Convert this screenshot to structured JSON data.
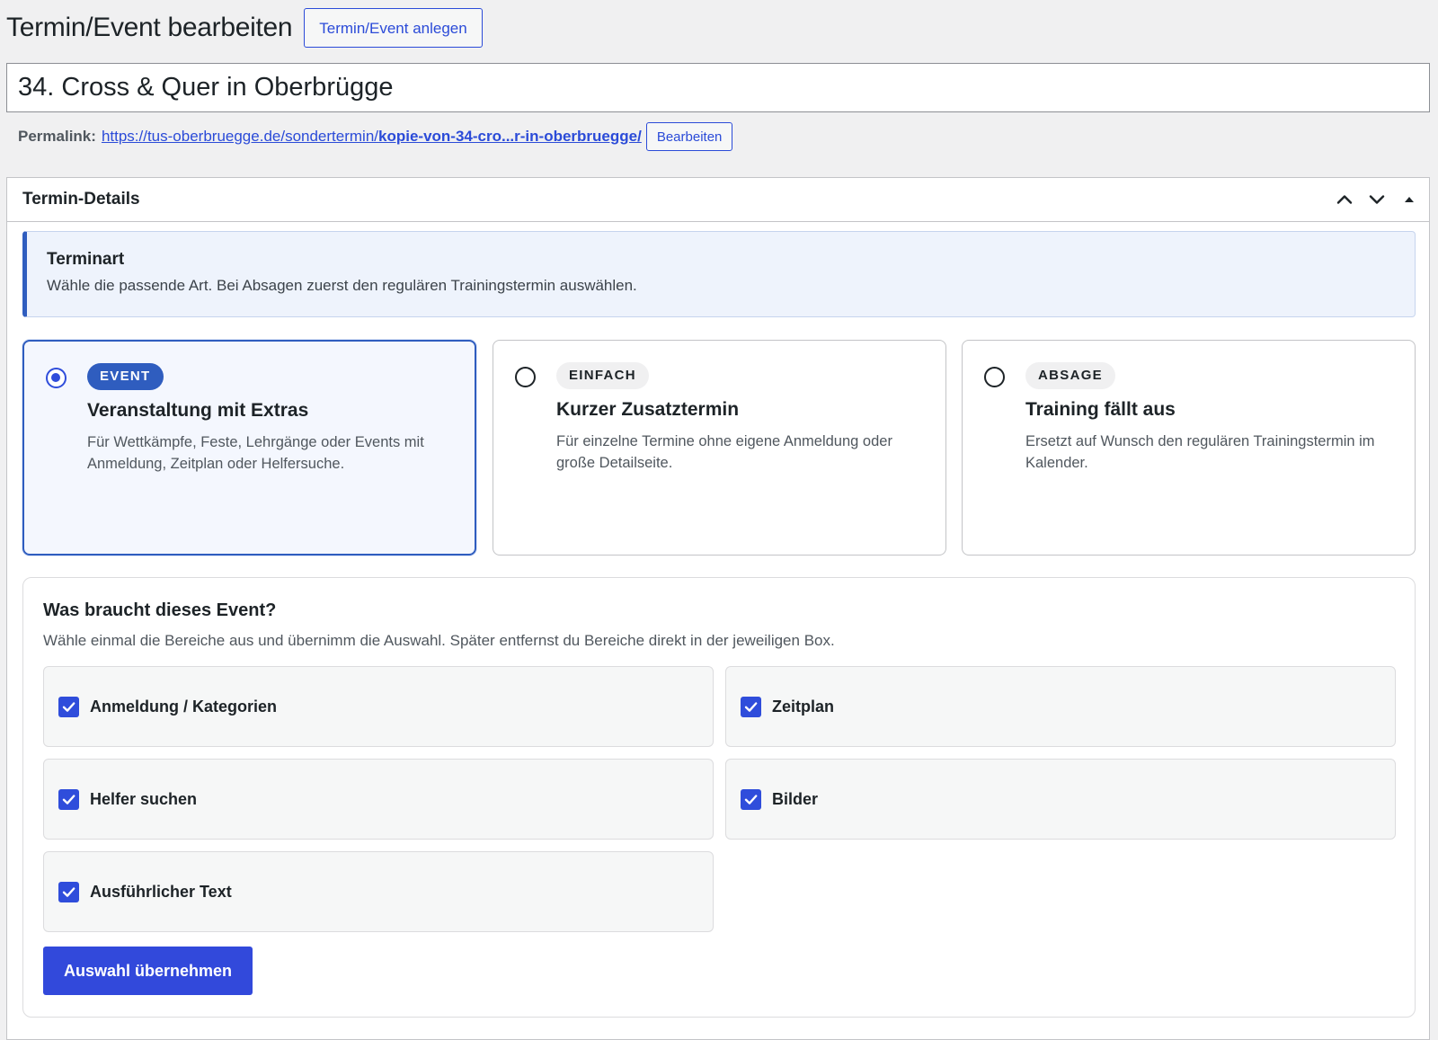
{
  "header": {
    "title": "Termin/Event bearbeiten",
    "add_new_label": "Termin/Event anlegen"
  },
  "post": {
    "title": "34. Cross & Quer in Oberbrügge",
    "permalink_label": "Permalink:",
    "permalink_base": "https://tus-oberbruegge.de/sondertermin/",
    "permalink_slug": "kopie-von-34-cro...r-in-oberbruegge/",
    "permalink_edit_label": "Bearbeiten"
  },
  "metabox": {
    "title": "Termin-Details",
    "actions": [
      "chevron-up-icon",
      "chevron-down-icon",
      "caret-up-icon"
    ],
    "notice": {
      "title": "Terminart",
      "text": "Wähle die passende Art. Bei Absagen zuerst den regulären Trainingstermin auswählen."
    },
    "types": [
      {
        "badge": "EVENT",
        "title": "Veranstaltung mit Extras",
        "description": "Für Wettkämpfe, Feste, Lehrgänge oder Events mit Anmeldung, Zeitplan oder Helfersuche.",
        "selected": true
      },
      {
        "badge": "EINFACH",
        "title": "Kurzer Zusatztermin",
        "description": "Für einzelne Termine ohne eigene Anmeldung oder große Detailseite.",
        "selected": false
      },
      {
        "badge": "ABSAGE",
        "title": "Training fällt aus",
        "description": "Ersetzt auf Wunsch den regulären Trainingstermin im Kalender.",
        "selected": false
      }
    ],
    "needs": {
      "title": "Was braucht dieses Event?",
      "subtitle": "Wähle einmal die Bereiche aus und übernimm die Auswahl. Später entfernst du Bereiche direkt in der jeweiligen Box.",
      "options": [
        {
          "label": "Anmeldung / Kategorien",
          "checked": true
        },
        {
          "label": "Zeitplan",
          "checked": true
        },
        {
          "label": "Helfer suchen",
          "checked": true
        },
        {
          "label": "Bilder",
          "checked": true
        },
        {
          "label": "Ausführlicher Text",
          "checked": true
        }
      ],
      "apply_label": "Auswahl übernehmen"
    }
  },
  "colors": {
    "accent": "#3249db",
    "selected_border": "#2f5dbf",
    "notice_bg": "#eef3fc",
    "page_bg": "#f0f0f1"
  }
}
